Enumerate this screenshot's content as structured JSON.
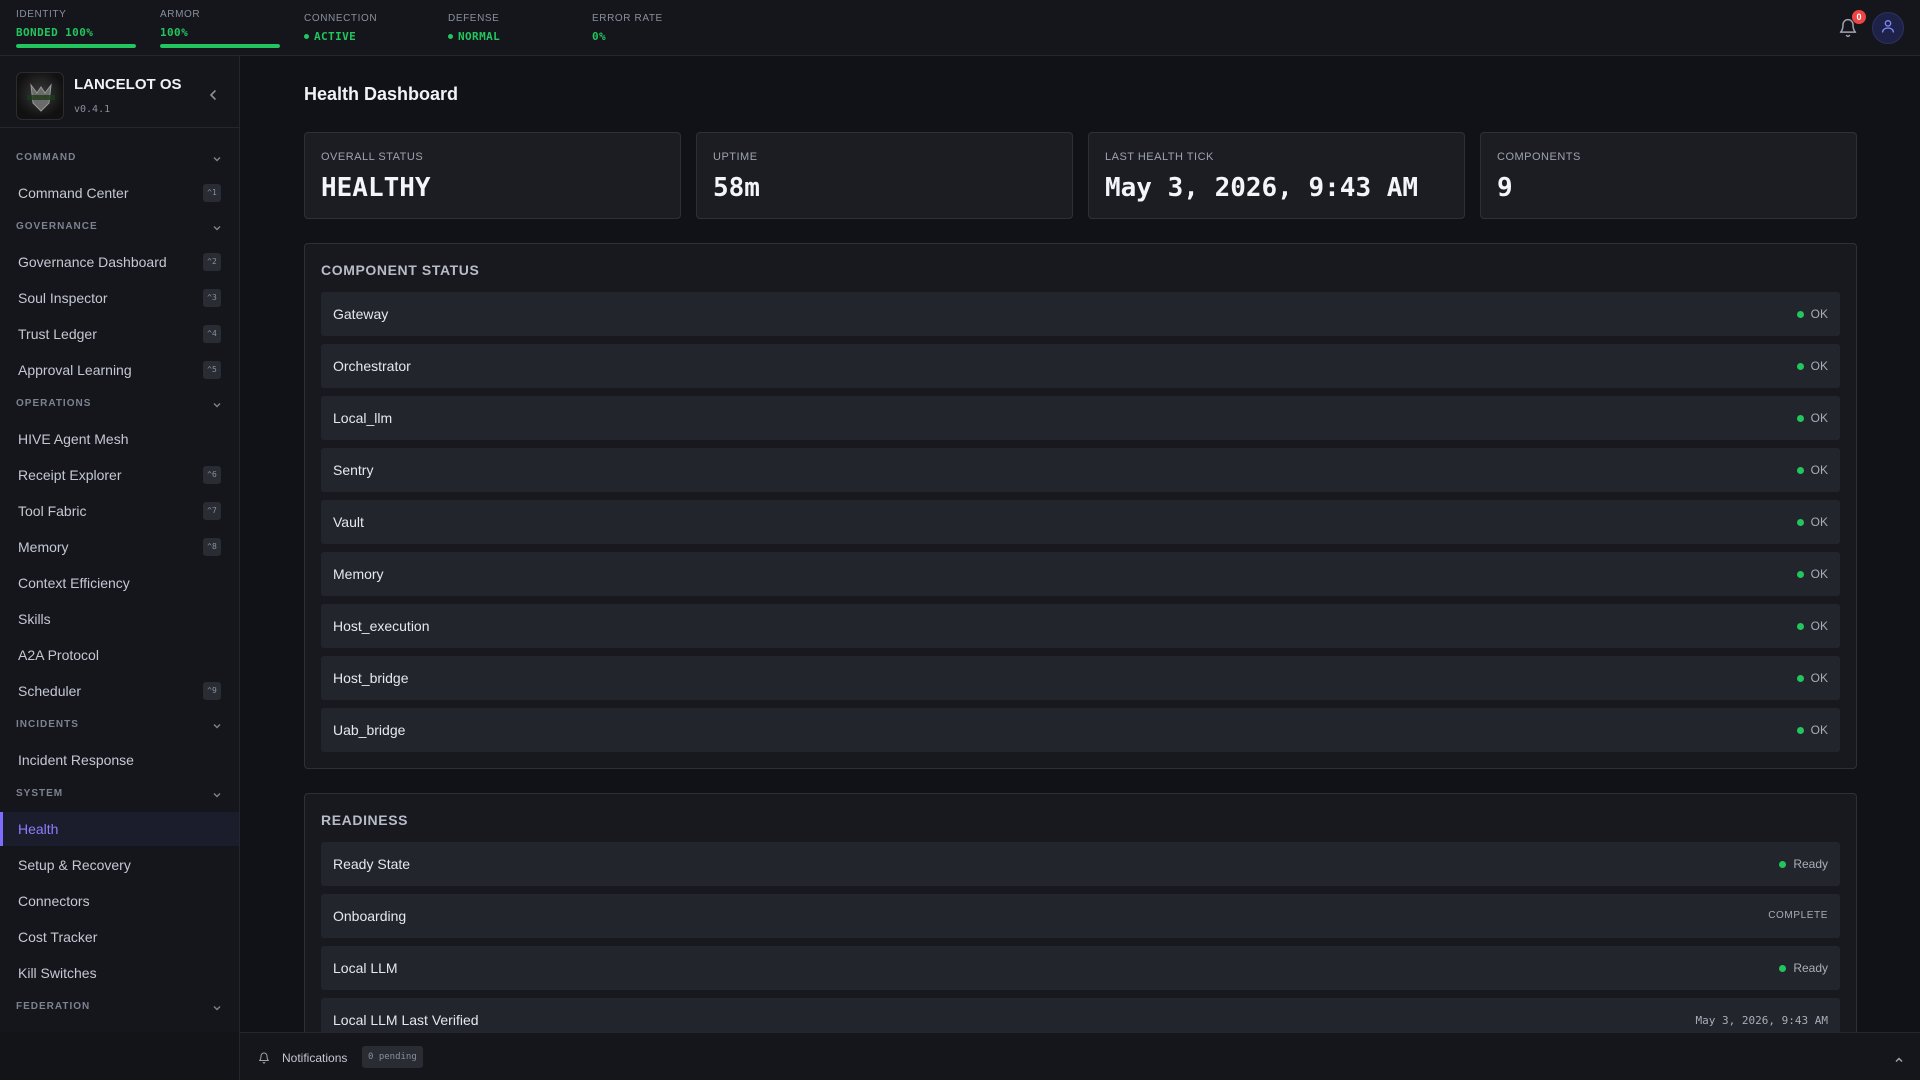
{
  "topbar": {
    "identity": {
      "label": "IDENTITY",
      "value": "BONDED 100%",
      "level": 1.0
    },
    "armor": {
      "label": "ARMOR",
      "value": "100%",
      "level": 1.0
    },
    "connection": {
      "label": "CONNECTION",
      "value": "ACTIVE"
    },
    "defense": {
      "label": "DEFENSE",
      "value": "NORMAL"
    },
    "error_rate": {
      "label": "ERROR RATE",
      "value": "0%"
    },
    "notifications_count": "0",
    "icons": {
      "bell": "bell-icon",
      "user": "user-icon"
    },
    "accent_ok": "#22c55e",
    "badge_color": "#ef4444"
  },
  "sidebar": {
    "brand_name": "LANCELOT OS",
    "version": "v0.4.1",
    "sections": {
      "command": "COMMAND",
      "governance": "GOVERNANCE",
      "operations": "OPERATIONS",
      "incidents": "INCIDENTS",
      "system": "SYSTEM",
      "federation": "FEDERATION"
    },
    "items": {
      "command_center": {
        "label": "Command Center",
        "shortcut": "^1"
      },
      "governance_dashboard": {
        "label": "Governance Dashboard",
        "shortcut": "^2"
      },
      "soul_inspector": {
        "label": "Soul Inspector",
        "shortcut": "^3"
      },
      "trust_ledger": {
        "label": "Trust Ledger",
        "shortcut": "^4"
      },
      "approval_learning": {
        "label": "Approval Learning",
        "shortcut": "^5"
      },
      "hive_agent_mesh": {
        "label": "HIVE Agent Mesh"
      },
      "receipt_explorer": {
        "label": "Receipt Explorer",
        "shortcut": "^6"
      },
      "tool_fabric": {
        "label": "Tool Fabric",
        "shortcut": "^7"
      },
      "memory": {
        "label": "Memory",
        "shortcut": "^8"
      },
      "context_efficiency": {
        "label": "Context Efficiency"
      },
      "skills": {
        "label": "Skills"
      },
      "a2a_protocol": {
        "label": "A2A Protocol"
      },
      "scheduler": {
        "label": "Scheduler",
        "shortcut": "^9"
      },
      "incident_response": {
        "label": "Incident Response"
      },
      "health": {
        "label": "Health"
      },
      "setup_recovery": {
        "label": "Setup & Recovery"
      },
      "connectors": {
        "label": "Connectors"
      },
      "cost_tracker": {
        "label": "Cost Tracker"
      },
      "kill_switches": {
        "label": "Kill Switches"
      }
    },
    "active_color": "#7c6cff"
  },
  "main": {
    "title": "Health Dashboard",
    "cards": {
      "overall_status": {
        "label": "OVERALL STATUS",
        "value": "HEALTHY"
      },
      "uptime": {
        "label": "UPTIME",
        "value": "58m"
      },
      "last_health_tick": {
        "label": "LAST HEALTH TICK",
        "value": "May 3, 2026, 9:43 AM"
      },
      "components": {
        "label": "COMPONENTS",
        "value": "9"
      }
    },
    "component_status": {
      "title": "COMPONENT STATUS",
      "rows": [
        {
          "name": "Gateway",
          "status": "OK"
        },
        {
          "name": "Orchestrator",
          "status": "OK"
        },
        {
          "name": "Local_llm",
          "status": "OK"
        },
        {
          "name": "Sentry",
          "status": "OK"
        },
        {
          "name": "Vault",
          "status": "OK"
        },
        {
          "name": "Memory",
          "status": "OK"
        },
        {
          "name": "Host_execution",
          "status": "OK"
        },
        {
          "name": "Host_bridge",
          "status": "OK"
        },
        {
          "name": "Uab_bridge",
          "status": "OK"
        }
      ]
    },
    "readiness": {
      "title": "READINESS",
      "rows": [
        {
          "name": "Ready State",
          "status": "Ready"
        },
        {
          "name": "Onboarding",
          "status": "COMPLETE"
        },
        {
          "name": "Local LLM",
          "status": "Ready"
        },
        {
          "name": "Local LLM Last Verified",
          "status": "May 3, 2026, 9:43 AM"
        }
      ]
    }
  },
  "bottombar": {
    "label": "Notifications",
    "pending": "0 pending"
  }
}
